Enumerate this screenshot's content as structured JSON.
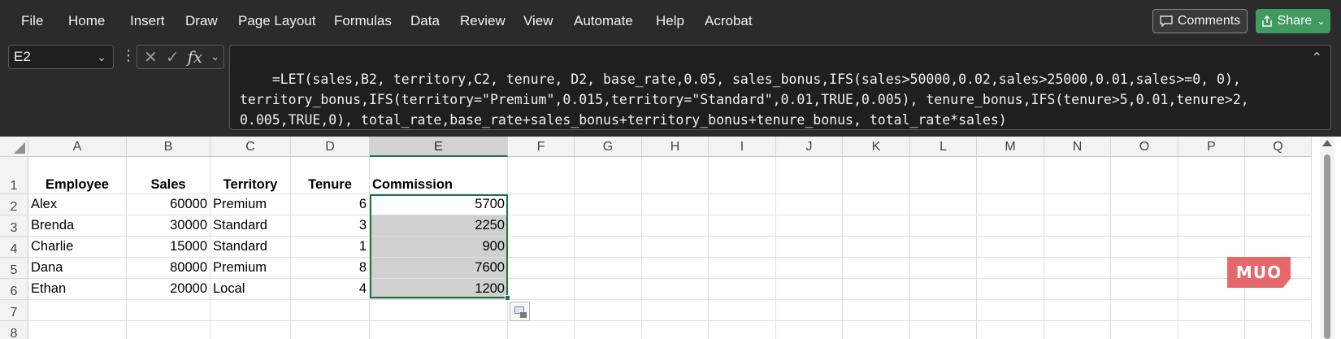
{
  "ribbon": {
    "menu": [
      "File",
      "Home",
      "Insert",
      "Draw",
      "Page Layout",
      "Formulas",
      "Data",
      "Review",
      "View",
      "Automate",
      "Help",
      "Acrobat"
    ],
    "comments_label": "Comments",
    "share_label": "Share"
  },
  "formula_bar": {
    "name_box": "E2",
    "fx_label": "fx",
    "formula": "=LET(sales,B2, territory,C2, tenure, D2, base_rate,0.05, sales_bonus,IFS(sales>50000,0.02,sales>25000,0.01,sales>=0, 0),\nterritory_bonus,IFS(territory=\"Premium\",0.015,territory=\"Standard\",0.01,TRUE,0.005), tenure_bonus,IFS(tenure>5,0.01,tenure>2,\n0.005,TRUE,0), total_rate,base_rate+sales_bonus+territory_bonus+tenure_bonus, total_rate*sales)"
  },
  "grid": {
    "columns": [
      "A",
      "B",
      "C",
      "D",
      "E",
      "F",
      "G",
      "H",
      "I",
      "J",
      "K",
      "L",
      "M",
      "N",
      "O",
      "P",
      "Q"
    ],
    "active_column": "E",
    "rows": [
      "1",
      "2",
      "3",
      "4",
      "5",
      "6",
      "7",
      "8"
    ],
    "headers": {
      "A": "Employee",
      "B": "Sales",
      "C": "Territory",
      "D": "Tenure",
      "E": "Commission"
    },
    "data": [
      {
        "employee": "Alex",
        "sales": "60000",
        "territory": "Premium",
        "tenure": "6",
        "commission": "5700"
      },
      {
        "employee": "Brenda",
        "sales": "30000",
        "territory": "Standard",
        "tenure": "3",
        "commission": "2250"
      },
      {
        "employee": "Charlie",
        "sales": "15000",
        "territory": "Standard",
        "tenure": "1",
        "commission": "900"
      },
      {
        "employee": "Dana",
        "sales": "80000",
        "territory": "Premium",
        "tenure": "8",
        "commission": "7600"
      },
      {
        "employee": "Ethan",
        "sales": "20000",
        "territory": "Local",
        "tenure": "4",
        "commission": "1200"
      }
    ]
  },
  "watermark": "MUO",
  "colors": {
    "selection": "#217346",
    "ribbon_bg": "#2b2b2b",
    "share_bg": "#3f9b5f",
    "logo": "#e7686a"
  }
}
